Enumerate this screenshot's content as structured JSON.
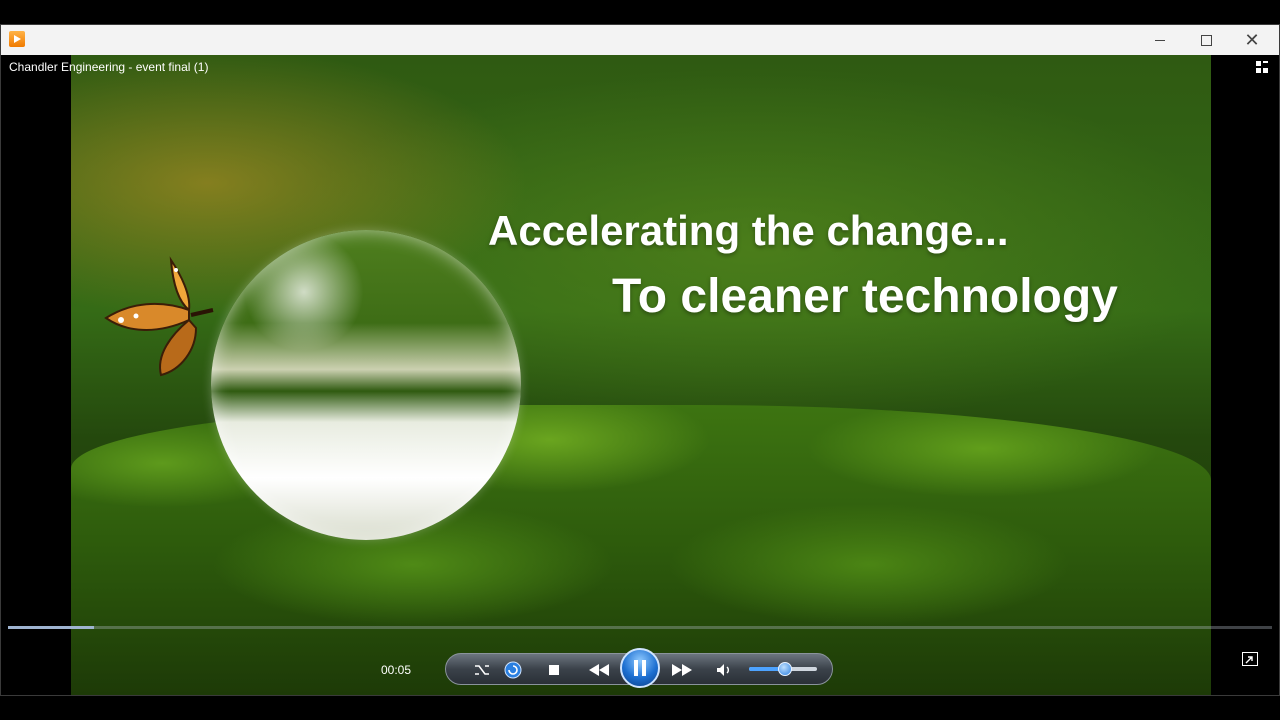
{
  "window": {
    "video_title": "Chandler Engineering - event final  (1)"
  },
  "video": {
    "headline_line1": "Accelerating the change...",
    "headline_line2": "To cleaner technology"
  },
  "playback": {
    "time_display": "00:05",
    "progress_fraction": 0.068,
    "volume_fraction": 0.52,
    "state": "playing"
  },
  "colors": {
    "accent": "#1d6fd1",
    "seek_fill": "#9fb4d0"
  },
  "icons": {
    "app": "media-player-icon",
    "layout": "switch-layout-icon",
    "shuffle": "shuffle-icon",
    "repeat": "repeat-icon",
    "stop": "stop-icon",
    "rewind": "rewind-icon",
    "pause": "pause-icon",
    "forward": "fast-forward-icon",
    "volume": "speaker-icon",
    "fullscreen": "fullscreen-icon"
  }
}
